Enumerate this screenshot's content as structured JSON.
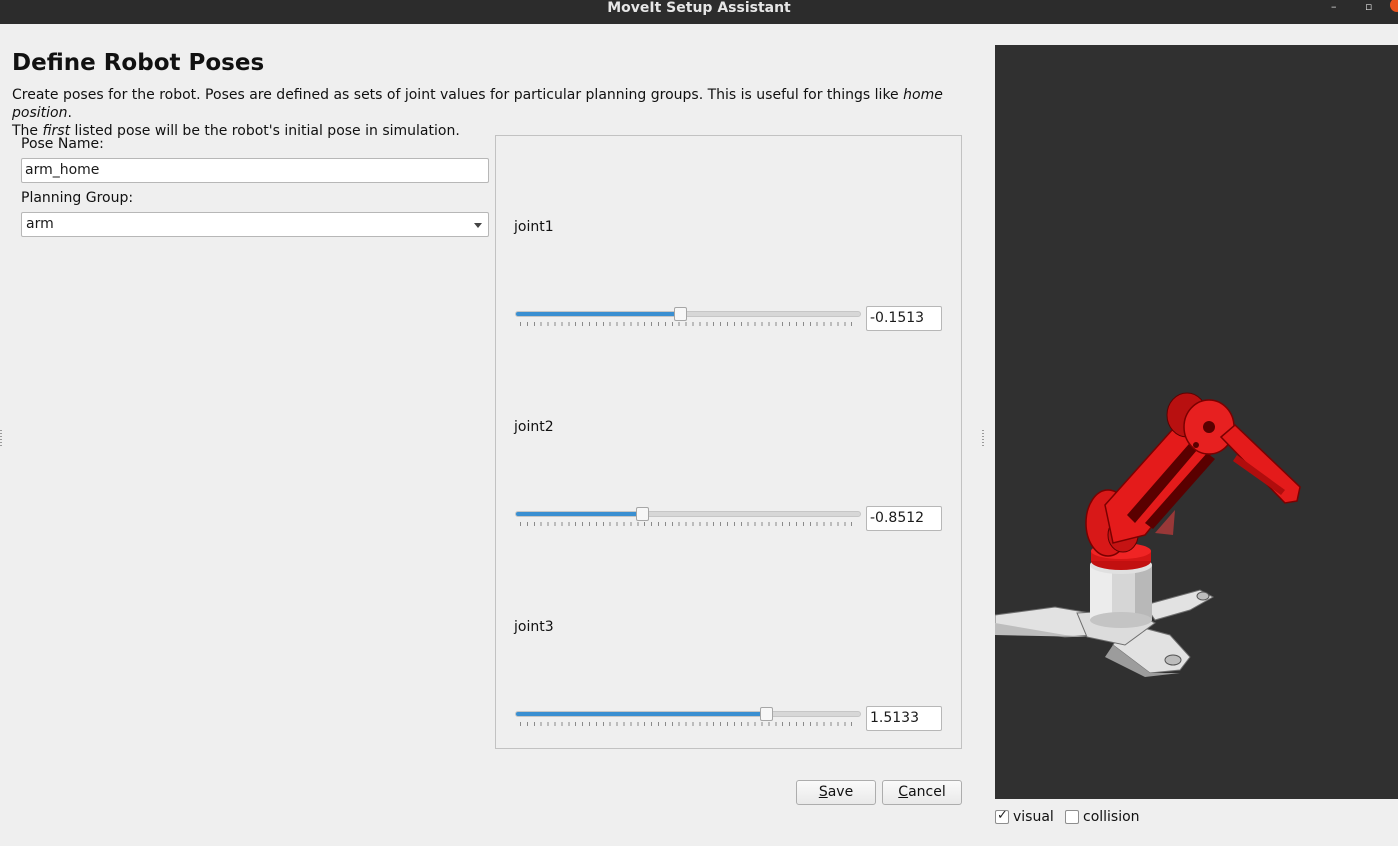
{
  "window": {
    "title": "MoveIt Setup Assistant",
    "min_symbol": "–",
    "max_symbol": "▫"
  },
  "page": {
    "heading": "Define Robot Poses",
    "desc_1": "Create poses for the robot. Poses are defined as sets of joint values for particular planning groups. This is useful for things like ",
    "desc_em1": "home position",
    "desc_2": ".",
    "desc_3": "The ",
    "desc_em2": "first",
    "desc_4": " listed pose will be the robot's initial pose in simulation."
  },
  "form": {
    "pose_name_label": "Pose Name:",
    "pose_name_value": "arm_home",
    "planning_group_label": "Planning Group:",
    "planning_group_value": "arm"
  },
  "joints": [
    {
      "name": "joint1",
      "value": "-0.1513",
      "slider_fraction": 0.48
    },
    {
      "name": "joint2",
      "value": "-0.8512",
      "slider_fraction": 0.37
    },
    {
      "name": "joint3",
      "value": "1.5133",
      "slider_fraction": 0.73
    }
  ],
  "buttons": {
    "save": {
      "pre": "",
      "u": "S",
      "post": "ave"
    },
    "cancel": {
      "pre": "",
      "u": "C",
      "post": "ancel"
    }
  },
  "viewer": {
    "visual_label": "visual",
    "visual_checked": true,
    "collision_label": "collision",
    "collision_checked": false,
    "background": "#303030",
    "robot_color": "#e61b1b"
  }
}
